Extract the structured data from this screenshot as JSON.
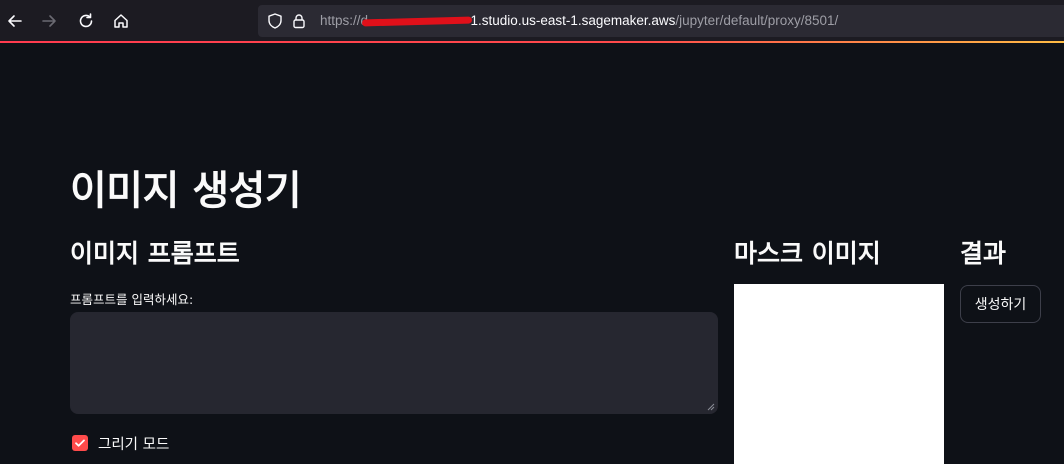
{
  "browser": {
    "url_prefix": "https://d-",
    "url_host": "1.studio.us-east-1.sagemaker.aws",
    "url_path": "/jupyter/default/proxy/8501/",
    "icons": [
      "back-icon",
      "forward-icon",
      "reload-icon",
      "home-icon",
      "shield-icon",
      "lock-icon"
    ]
  },
  "app": {
    "title": "이미지 생성기",
    "prompt_section": {
      "heading": "이미지 프롬프트",
      "input_label": "프롬프트를 입력하세요:",
      "input_value": "",
      "draw_mode_label": "그리기 모드",
      "draw_mode_checked": true
    },
    "mask_section": {
      "heading": "마스크 이미지"
    },
    "result_section": {
      "heading": "결과",
      "generate_button": "생성하기"
    }
  },
  "colors": {
    "background": "#0e1117",
    "accent": "#ff4b4b",
    "input_background": "#262730",
    "browser_chrome": "#1c1b22"
  }
}
